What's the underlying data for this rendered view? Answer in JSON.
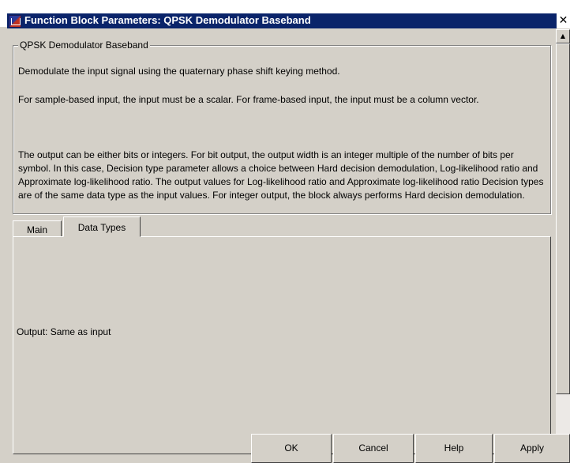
{
  "window": {
    "title": "Function Block Parameters: QPSK Demodulator Baseband",
    "close_glyph": "✕"
  },
  "description": {
    "legend": "QPSK Demodulator Baseband",
    "paragraphs": [
      "Demodulate the input signal using the quaternary phase shift keying method.",
      "For sample-based input, the input must be a scalar. For frame-based input, the input must be a column vector.",
      "The output can be either bits or integers. For bit output, the output width is an integer multiple of the number of bits per symbol. In this case, Decision type parameter allows a choice between Hard decision demodulation, Log-likelihood ratio and Approximate log-likelihood ratio.  The output values for Log-likelihood ratio and Approximate log-likelihood ratio Decision types are of the same data type as the input values. For integer output, the block always performs Hard decision demodulation."
    ]
  },
  "tabs": [
    {
      "label": "Main",
      "active": false
    },
    {
      "label": "Data Types",
      "active": true
    }
  ],
  "data_types_panel": {
    "output_label": "Output: Same as input"
  },
  "scrollbar": {
    "up_glyph": "▲",
    "down_glyph": "▼"
  },
  "buttons": {
    "ok": "OK",
    "cancel": "Cancel",
    "help": "Help",
    "apply": "Apply"
  },
  "colors": {
    "title_bar": "#0a246a",
    "window_bg": "#d4d0c8"
  }
}
